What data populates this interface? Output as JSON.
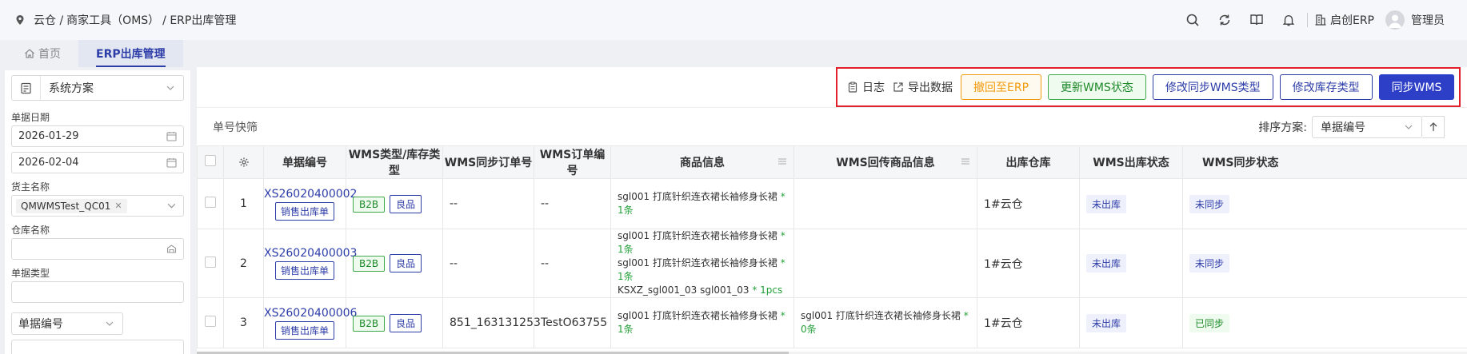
{
  "header": {
    "breadcrumb": [
      "云仓 /",
      "商家工具（OMS）",
      "/ ERP出库管理"
    ],
    "erp_label": "启创ERP",
    "user_name": "管理员"
  },
  "tabs": [
    {
      "label": "首页",
      "active": false
    },
    {
      "label": "ERP出库管理",
      "active": true
    }
  ],
  "filters": {
    "scheme_value": "系统方案",
    "date_label": "单据日期",
    "date_from": "2026-01-29",
    "date_to": "2026-02-04",
    "owner_label": "货主名称",
    "owner_tag": "QMWMSTest_QC01",
    "warehouse_label": "仓库名称",
    "warehouse_value": "",
    "doc_type_label": "单据类型",
    "doc_type_value": "",
    "search_field": "单据编号",
    "search_value": ""
  },
  "toolbar": {
    "log": "日志",
    "export": "导出数据",
    "revoke": "撤回至ERP",
    "update_wms": "更新WMS状态",
    "modify_sync_type": "修改同步WMS类型",
    "modify_stock_type": "修改库存类型",
    "sync_wms": "同步WMS"
  },
  "quickfilter": {
    "label": "单号快筛",
    "sort_label": "排序方案:",
    "sort_value": "单据编号"
  },
  "table": {
    "columns": [
      "单据编号",
      "WMS类型/库存类型",
      "WMS同步订单号",
      "WMS订单编号",
      "商品信息",
      "WMS回传商品信息",
      "出库仓库",
      "WMS出库状态",
      "WMS同步状态"
    ],
    "rows": [
      {
        "idx": "1",
        "order_no": "XS26020400002",
        "order_type": "销售出库单",
        "wms_type": "B2B",
        "stock_type": "良品",
        "sync_order": "--",
        "wms_order": "--",
        "goods": [
          {
            "name": "sgl001 打底针织连衣裙长袖修身长裙",
            "qty": "* 1条"
          }
        ],
        "return_goods": [],
        "warehouse": "1#云仓",
        "out_status": "未出库",
        "sync_status": "未同步"
      },
      {
        "idx": "2",
        "order_no": "XS26020400003",
        "order_type": "销售出库单",
        "wms_type": "B2B",
        "stock_type": "良品",
        "sync_order": "--",
        "wms_order": "--",
        "goods": [
          {
            "name": "sgl001 打底针织连衣裙长袖修身长裙",
            "qty": "* 1条"
          },
          {
            "name": "sgl001 打底针织连衣裙长袖修身长裙",
            "qty": "* 1条"
          },
          {
            "name": "KSXZ_sgl001_03 sgl001_03",
            "qty": "* 1pcs"
          }
        ],
        "return_goods": [],
        "warehouse": "1#云仓",
        "out_status": "未出库",
        "sync_status": "未同步"
      },
      {
        "idx": "3",
        "order_no": "XS26020400006",
        "order_type": "销售出库单",
        "wms_type": "B2B",
        "stock_type": "良品",
        "sync_order": "851_163131253",
        "wms_order": "TestO63755",
        "goods": [
          {
            "name": "sgl001 打底针织连衣裙长袖修身长裙",
            "qty": "* 1条"
          }
        ],
        "return_goods": [
          {
            "name": "sgl001 打底针织连衣裙长袖修身长裙",
            "qty": "* 0条"
          }
        ],
        "warehouse": "1#云仓",
        "out_status": "未出库",
        "sync_status": "已同步"
      }
    ]
  }
}
